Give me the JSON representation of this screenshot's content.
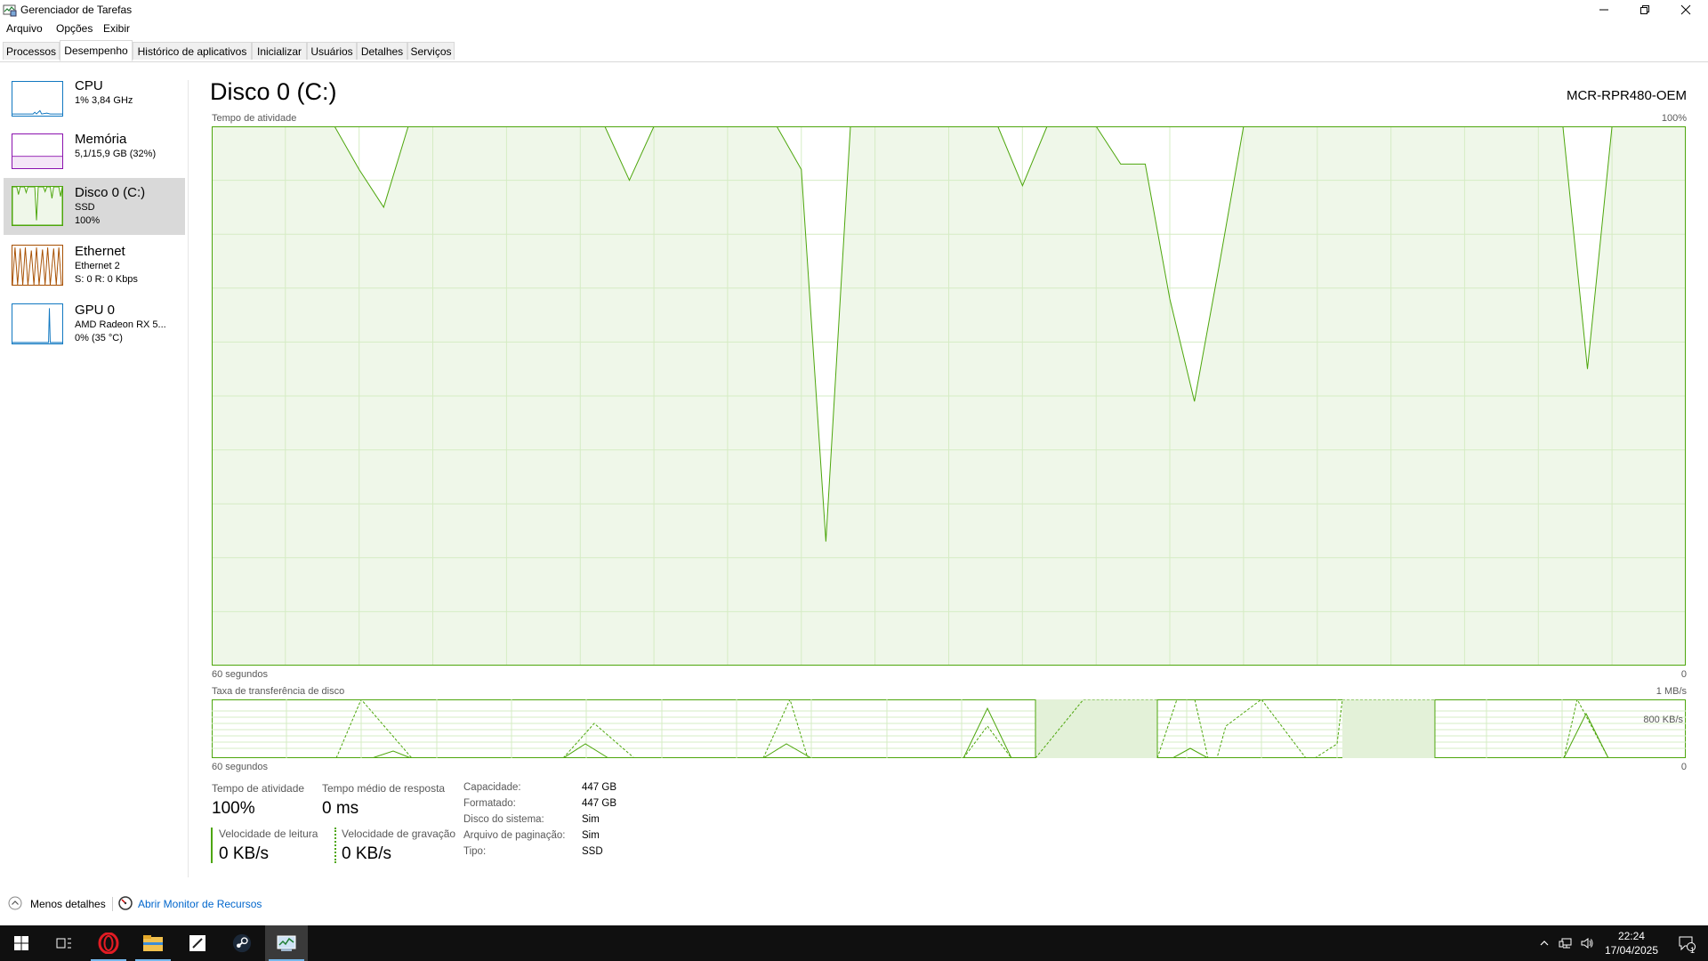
{
  "window": {
    "title": "Gerenciador de Tarefas"
  },
  "menu": [
    "Arquivo",
    "Opções",
    "Exibir"
  ],
  "tabs": [
    "Processos",
    "Desempenho",
    "Histórico de aplicativos",
    "Inicializar",
    "Usuários",
    "Detalhes",
    "Serviços"
  ],
  "active_tab": "Desempenho",
  "sidebar": [
    {
      "name": "CPU",
      "line1": "1% 3,84 GHz",
      "line2": "",
      "color": "#1178c1"
    },
    {
      "name": "Memória",
      "line1": "5,1/15,9 GB (32%)",
      "line2": "",
      "color": "#8b12ae"
    },
    {
      "name": "Disco 0 (C:)",
      "line1": "SSD",
      "line2": "100%",
      "color": "#4da60c"
    },
    {
      "name": "Ethernet",
      "line1": "Ethernet 2",
      "line2": "S: 0 R: 0 Kbps",
      "color": "#a74f01"
    },
    {
      "name": "GPU 0",
      "line1": "AMD Radeon RX 5...",
      "line2": "0% (35 °C)",
      "color": "#1178c1"
    }
  ],
  "selected_sidebar": "Disco 0 (C:)",
  "main": {
    "title": "Disco 0 (C:)",
    "model": "MCR-RPR480-OEM",
    "activity_label": "Tempo de atividade",
    "activity_max": "100%",
    "time_label": "60 segundos",
    "zero": "0",
    "transfer_label": "Taxa de transferência de disco",
    "transfer_max": "1 MB/s",
    "transfer_mid": "800 KB/s",
    "accent": "#4da60c",
    "fill": "#eff7e9"
  },
  "stats": {
    "activity_label": "Tempo de atividade",
    "activity_value": "100%",
    "response_label": "Tempo médio de resposta",
    "response_value": "0 ms",
    "read_label": "Velocidade de leitura",
    "read_value": "0 KB/s",
    "write_label": "Velocidade de gravação",
    "write_value": "0 KB/s"
  },
  "properties": [
    {
      "key": "Capacidade:",
      "value": "447 GB"
    },
    {
      "key": "Formatado:",
      "value": "447 GB"
    },
    {
      "key": "Disco do sistema:",
      "value": "Sim"
    },
    {
      "key": "Arquivo de paginação:",
      "value": "Sim"
    },
    {
      "key": "Tipo:",
      "value": "SSD"
    }
  ],
  "footer": {
    "fewer_details": "Menos detalhes",
    "open_resource_monitor": "Abrir Monitor de Recursos"
  },
  "taskbar": {
    "time": "22:24",
    "date": "17/04/2025",
    "notification_count": "1",
    "apps": [
      "start-icon",
      "task-view-icon",
      "opera-icon",
      "file-explorer-icon",
      "notepad-icon",
      "steam-icon",
      "task-manager-icon"
    ]
  },
  "chart_data": {
    "type": "area",
    "title": "Tempo de atividade",
    "xlabel": "60 segundos",
    "ylabel": "",
    "xlim": [
      60,
      0
    ],
    "ylim": [
      0,
      100
    ],
    "x": [
      60,
      59,
      58,
      57,
      56,
      55,
      54,
      53,
      52,
      51,
      50,
      49,
      48,
      47,
      46,
      45,
      44,
      43,
      42,
      41,
      40,
      39,
      38,
      37,
      36,
      35,
      34,
      33,
      32,
      31,
      30,
      29,
      28,
      27,
      26,
      25,
      24,
      23,
      22,
      21,
      20,
      19,
      18,
      17,
      16,
      15,
      14,
      13,
      12,
      11,
      10,
      9,
      8,
      7,
      6,
      5,
      4,
      3,
      2,
      1,
      0
    ],
    "activity": [
      100,
      100,
      100,
      100,
      100,
      100,
      92,
      85,
      100,
      100,
      100,
      100,
      100,
      100,
      100,
      100,
      100,
      90,
      100,
      100,
      100,
      100,
      100,
      100,
      92,
      23,
      100,
      100,
      100,
      100,
      100,
      100,
      100,
      89,
      100,
      100,
      100,
      93,
      93,
      68,
      49,
      74,
      100,
      100,
      100,
      100,
      100,
      100,
      100,
      100,
      100,
      100,
      100,
      100,
      100,
      100,
      55,
      100,
      100,
      100,
      100
    ]
  }
}
